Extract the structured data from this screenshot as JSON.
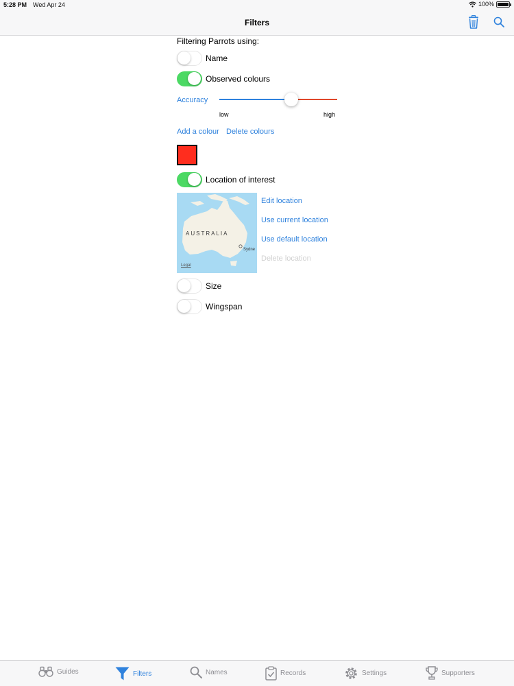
{
  "status_bar": {
    "time": "5:28 PM",
    "date": "Wed Apr 24",
    "battery": "100%",
    "battery_level": 1.0
  },
  "nav": {
    "title": "Filters"
  },
  "filters": {
    "heading": "Filtering Parrots using:",
    "name_toggle": {
      "label": "Name",
      "on": false
    },
    "colours_toggle": {
      "label": "Observed colours",
      "on": true
    },
    "accuracy": {
      "label": "Accuracy",
      "value": 0.61,
      "low": "low",
      "high": "high"
    },
    "add_colour": "Add a colour",
    "delete_colours": "Delete colours",
    "colour_swatch": "#ff2d1e",
    "location_toggle": {
      "label": "Location of interest",
      "on": true
    },
    "map": {
      "region_label": "AUSTRALIA",
      "city_label": "Sydne",
      "legal": "Legal"
    },
    "location_actions": {
      "edit": "Edit location",
      "current": "Use current location",
      "default": "Use default location",
      "delete": "Delete location"
    },
    "size_toggle": {
      "label": "Size",
      "on": false
    },
    "wingspan_toggle": {
      "label": "Wingspan",
      "on": false
    }
  },
  "tabs": [
    {
      "label": "Guides",
      "icon": "binoculars-icon"
    },
    {
      "label": "Filters",
      "icon": "funnel-icon",
      "active": true
    },
    {
      "label": "Names",
      "icon": "magnifier-icon"
    },
    {
      "label": "Records",
      "icon": "clipboard-check-icon"
    },
    {
      "label": "Settings",
      "icon": "gear-icon"
    },
    {
      "label": "Supporters",
      "icon": "trophy-icon"
    }
  ],
  "colors": {
    "accent": "#2f82dd",
    "toggle_on": "#4cd964",
    "slider_max": "#e0472a",
    "map_water": "#a8daf3",
    "map_land": "#f4f1e6"
  }
}
